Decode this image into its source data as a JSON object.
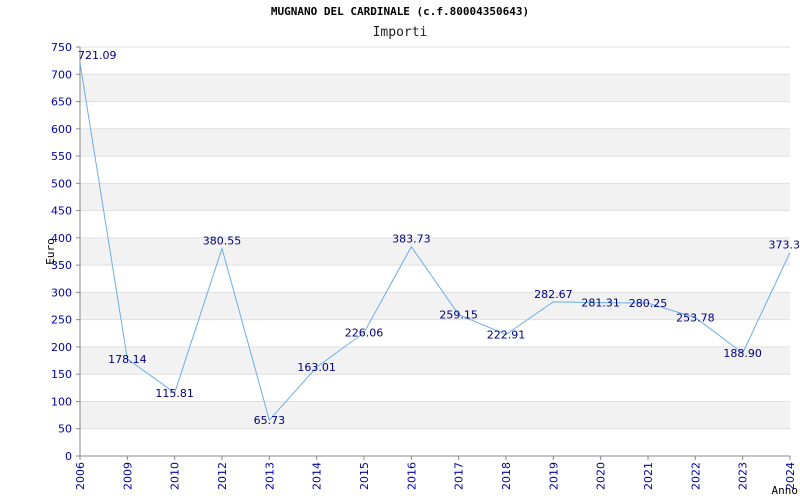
{
  "title": "MUGNANO DEL CARDINALE (c.f.80004350643)",
  "subtitle": "Importi",
  "colors": {
    "line": "#6aaee8",
    "tick_text": "#0000aa",
    "data_label": "#000080",
    "band": "#f2f2f2",
    "grid": "#e0e0e0",
    "axis": "#888888"
  },
  "chart_data": {
    "type": "line",
    "title": "MUGNANO DEL CARDINALE (c.f.80004350643)",
    "subtitle": "Importi",
    "xlabel": "Anno",
    "ylabel": "Euro",
    "ylim": [
      0,
      750
    ],
    "y_ticks": [
      "0",
      "50",
      "100",
      "150",
      "200",
      "250",
      "300",
      "350",
      "400",
      "450",
      "500",
      "550",
      "600",
      "650",
      "700",
      "750"
    ],
    "grid": true,
    "categories": [
      "2006",
      "2009",
      "2010",
      "2012",
      "2013",
      "2014",
      "2015",
      "2016",
      "2017",
      "2018",
      "2019",
      "2020",
      "2021",
      "2022",
      "2023",
      "2024"
    ],
    "values": [
      721.09,
      178.14,
      115.81,
      380.55,
      65.73,
      163.01,
      226.06,
      383.73,
      259.15,
      222.91,
      282.67,
      281.31,
      280.25,
      253.78,
      188.9,
      373.3
    ],
    "data_labels": [
      "721.09",
      "178.14",
      "115.81",
      "380.55",
      "65.73",
      "163.01",
      "226.06",
      "383.73",
      "259.15",
      "222.91",
      "282.67",
      "281.31",
      "280.25",
      "253.78",
      "188.90",
      "373.3"
    ]
  }
}
